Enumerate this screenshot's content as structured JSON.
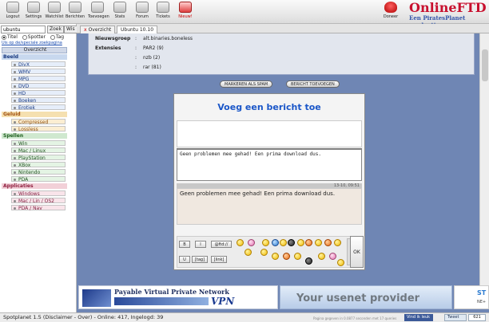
{
  "toolbar": {
    "buttons": [
      {
        "label": "Logout"
      },
      {
        "label": "Settings"
      },
      {
        "label": "Watchlist"
      },
      {
        "label": "Berichten"
      },
      {
        "label": "Toevoegen"
      },
      {
        "label": "Stats"
      },
      {
        "label": "Forum"
      },
      {
        "label": "Tickets"
      },
      {
        "label": "Nieuw!"
      }
    ],
    "donate_label": "Doneer",
    "logo_title": "OnlineFTD",
    "logo_subtitle": "Een PiratesPlanet productie"
  },
  "sidebar": {
    "search_value": "ubuntu",
    "search_button": "Zoek",
    "wis_button": "Wis",
    "radio_titel": "Titel",
    "radio_spotter": "Spotter",
    "radio_tag": "Tag",
    "ext_link": "Uis op de/speciale zoekpagina",
    "overzicht": "Overzicht",
    "categories": [
      {
        "title": "Beeld",
        "color": "blue",
        "items": [
          "DivX",
          "WMV",
          "MPG",
          "DVD",
          "HD",
          "Boeken",
          "Erotiek"
        ]
      },
      {
        "title": "Geluid",
        "color": "orange",
        "items": [
          "Compressed",
          "Lossless"
        ]
      },
      {
        "title": "Spellen",
        "color": "green",
        "items": [
          "Win",
          "Mac / Linux",
          "PlayStation",
          "XBox",
          "Nintendo",
          "PDA"
        ]
      },
      {
        "title": "Applicaties",
        "color": "pink",
        "items": [
          "Windows",
          "Mac / Lin / OS2",
          "PDA / Nav"
        ]
      }
    ]
  },
  "tabs": [
    {
      "label": "Overzicht",
      "close": "x"
    },
    {
      "label": "Ubuntu 10.10"
    }
  ],
  "info": [
    {
      "key": "Nieuwsgroep",
      "value": "alt.binaries.boneless"
    },
    {
      "key": "Extensies",
      "value": "PAR2 (9)"
    },
    {
      "key": "",
      "value": "nzb (2)"
    },
    {
      "key": "",
      "value": "rar (81)"
    }
  ],
  "actions": {
    "spam_label": "MARKEREN ALS SPAM",
    "add_label": "BERICHT TOEVOEGEN"
  },
  "dialog": {
    "title": "Voeg een bericht toe",
    "textarea_value": "Geen problemen mee gehad! Een prima download dus.",
    "preview_date": "13-10, 09:51",
    "preview_text": "Geen problemen mee gehad! Een prima download dus.",
    "format_buttons": [
      "B",
      "I",
      "@ftd://",
      "U",
      "[tag]",
      "[link]"
    ],
    "ok_label": "OK"
  },
  "ads": {
    "ad1_title": "Payable Virtual Private Network",
    "ad1_vpn": "VPN",
    "ad2_text": "Your usenet provider",
    "ad3_a": "ST",
    "ad3_b": "NE+"
  },
  "status": {
    "text": "Spotplanet 1.5 (Disclaimer - Over) - Online: 417, Ingelogd: 39",
    "generated": "Pagina gegeven in 0.0877 seconden met 17 queries",
    "fb_label": "Vind ik leuk",
    "tw_label": "Tweet",
    "count": "621"
  },
  "colors": {
    "main_bg": "#6f86b4",
    "title_blue": "#1a56c8",
    "logo_red": "#c8102e"
  }
}
